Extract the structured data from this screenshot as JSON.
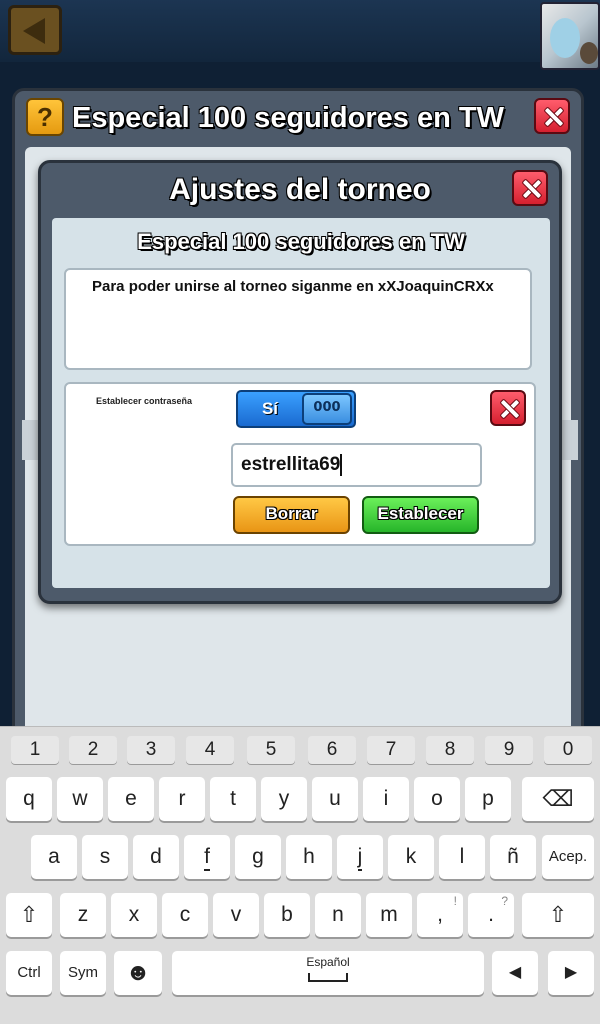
{
  "back_panel": {
    "help_icon_text": "?",
    "title": "Especial 100 seguidores en TW"
  },
  "dialog": {
    "title": "Ajustes del torneo",
    "tournament_name": "Especial 100 seguidores en TW",
    "description": "Para poder unirse al torneo siganme en xXJoaquinCRXx",
    "password_label": "Establecer contraseña",
    "toggle_label": "Sí",
    "toggle_knob_text": "000",
    "password_value": "estrellita69",
    "clear_label": "Borrar",
    "set_label": "Establecer"
  },
  "keyboard": {
    "number_row": [
      "1",
      "2",
      "3",
      "4",
      "5",
      "6",
      "7",
      "8",
      "9",
      "0"
    ],
    "row1": [
      "q",
      "w",
      "e",
      "r",
      "t",
      "y",
      "u",
      "i",
      "o",
      "p"
    ],
    "row2": [
      "a",
      "s",
      "d",
      "f",
      "g",
      "h",
      "j",
      "k",
      "l",
      "ñ"
    ],
    "row3": [
      "z",
      "x",
      "c",
      "v",
      "b",
      "n",
      "m"
    ],
    "accept_label": "Acep.",
    "comma_label": ",",
    "comma_sub": "!",
    "period_label": ".",
    "period_sub": "?",
    "ctrl_label": "Ctrl",
    "sym_label": "Sym",
    "space_label": "Español",
    "left_arrow": "◀",
    "right_arrow": "▶",
    "shift_symbol": "⇧",
    "backspace_symbol": "⌫",
    "emoji_symbol": "☻"
  },
  "colors": {
    "background": "#0f2034",
    "panel": "#4d5a6a",
    "accept_green": "#27b52a",
    "clear_orange": "#e99515",
    "toggle_blue": "#1a6ad0",
    "close_red": "#d5202f"
  }
}
